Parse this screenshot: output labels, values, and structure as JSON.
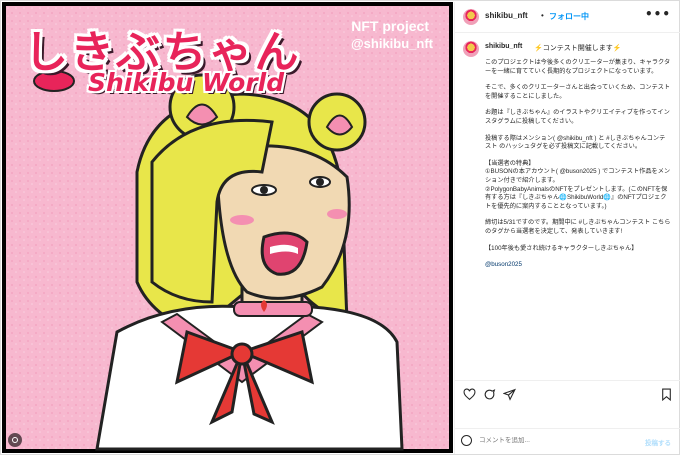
{
  "image": {
    "title_jp": "しきぶちゃん",
    "title_en": "Shikibu World",
    "nft_project": "NFT project",
    "nft_handle": "@shikibu_nft"
  },
  "header": {
    "username": "shikibu_nft",
    "dot": "•",
    "follow": "フォロー中",
    "more": "•••"
  },
  "caption": {
    "username": "shikibu_nft",
    "first_line": "⚡コンテスト開催します⚡",
    "paragraphs": [
      "このプロジェクトは今後多くのクリエーターが集まり、キャラクターを一緒に育てていく長期的なプロジェクトになっています。",
      "そこで、多くのクリエーターさんと出会っていくため、コンテストを開催することにしました。",
      "お題は『しきぶちゃん』のイラストやクリエイティブを作ってインスタグラムに投稿してください。",
      "投稿する際はメンション( @shikibu_nft ) と #しきぶちゃんコンテスト のハッシュタグを必ず投稿文に記載してください。",
      "【当選者の特典】\n①BUSONの本アカウント( @buson2025 ) でコンテスト作品をメンション付きで紹介します。\n②PolygonBabyAnimalsのNFTをプレゼントします。(このNFTを保有する方は『しきぶちゃん🌐ShikibuWorld🌐』のNFTプロジェクトを優先的に案内することとなっています。)",
      "締切は5/31ですのです。期間中に #しきぶちゃんコンテスト こちらのタグから当選者を決定して、発表していきます!",
      "【100年後も愛され続けるキャラクターしきぶちゃん】",
      "@buson2025"
    ]
  },
  "comment": {
    "placeholder": "コメントを追加...",
    "post": "投稿する"
  },
  "colors": {
    "brand_pink": "#e8245a",
    "link": "#00376b",
    "follow_blue": "#0095f6",
    "bg_pink": "#f7b8cf",
    "hair_yellow": "#e8e64a"
  },
  "icons": [
    "heart-icon",
    "comment-icon",
    "share-icon",
    "bookmark-icon",
    "emoji-icon",
    "more-icon",
    "multi-image-icon"
  ]
}
